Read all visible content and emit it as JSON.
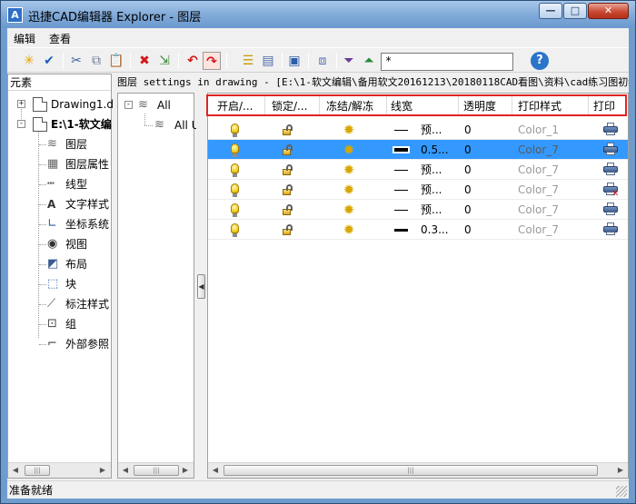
{
  "window": {
    "title": "迅捷CAD编辑器 Explorer - 图层",
    "app_icon": "A",
    "controls": {
      "minimize": "—",
      "maximize": "□",
      "close": "✕"
    }
  },
  "menu": [
    {
      "label": "编辑"
    },
    {
      "label": "查看"
    }
  ],
  "toolbar": {
    "filter_value": "*",
    "help_label": "?",
    "icons": [
      "new-icon",
      "check-icon",
      "cut-icon",
      "copy-icon",
      "paste-icon",
      "delete-icon",
      "export-icon",
      "undo-icon",
      "redo-icon",
      "layer-state-icon",
      "layer-filter-icon",
      "layer-props-icon",
      "layer-merge-icon",
      "filter-icon",
      "filter-invert-icon",
      "help-icon"
    ]
  },
  "left_panel": {
    "header": "元素",
    "tree": [
      {
        "label": "Drawing1.d",
        "level": 0,
        "expander": "+"
      },
      {
        "label": "E:\\1-软文编",
        "level": 0,
        "expander": "-",
        "bold": true
      },
      {
        "label": "图层",
        "level": 1,
        "icon": "layers-icon"
      },
      {
        "label": "图层属性",
        "level": 1,
        "icon": "layer-properties-icon"
      },
      {
        "label": "线型",
        "level": 1,
        "icon": "linetype-icon"
      },
      {
        "label": "文字样式",
        "level": 1,
        "icon": "text-style-icon"
      },
      {
        "label": "坐标系统",
        "level": 1,
        "icon": "ucs-icon"
      },
      {
        "label": "视图",
        "level": 1,
        "icon": "eye-icon"
      },
      {
        "label": "布局",
        "level": 1,
        "icon": "layout-icon"
      },
      {
        "label": "块",
        "level": 1,
        "icon": "block-icon"
      },
      {
        "label": "标注样式",
        "level": 1,
        "icon": "dimension-style-icon"
      },
      {
        "label": "组",
        "level": 1,
        "icon": "group-icon"
      },
      {
        "label": "外部参照",
        "level": 1,
        "icon": "xref-icon"
      }
    ]
  },
  "path_bar": "图层 settings in drawing - [E:\\1-软文编辑\\备用软文20161213\\20180118CAD看图\\资料\\cad练习图初级",
  "filter_tree": [
    {
      "label": "All",
      "expander": "-"
    },
    {
      "label": "All U"
    }
  ],
  "grid": {
    "columns": [
      "开启/...",
      "锁定/...",
      "冻结/解冻",
      "线宽",
      "透明度",
      "打印样式",
      "打印"
    ],
    "rows": [
      {
        "linewidth": "预...",
        "lw_weight": 1,
        "transparency": "0",
        "plot_style": "Color_1",
        "plottable": true,
        "selected": false
      },
      {
        "linewidth": "0.5...",
        "lw_weight": 4,
        "transparency": "0",
        "plot_style": "Color_7",
        "plottable": true,
        "selected": true
      },
      {
        "linewidth": "预...",
        "lw_weight": 1,
        "transparency": "0",
        "plot_style": "Color_7",
        "plottable": true,
        "selected": false
      },
      {
        "linewidth": "预...",
        "lw_weight": 1,
        "transparency": "0",
        "plot_style": "Color_7",
        "plottable": false,
        "selected": false
      },
      {
        "linewidth": "预...",
        "lw_weight": 1,
        "transparency": "0",
        "plot_style": "Color_7",
        "plottable": true,
        "selected": false
      },
      {
        "linewidth": "0.3...",
        "lw_weight": 3,
        "transparency": "0",
        "plot_style": "Color_7",
        "plottable": true,
        "selected": false
      }
    ]
  },
  "status": "准备就绪",
  "colors": {
    "selection": "#3399ff",
    "highlight_border": "#e02424",
    "title_gradient_top": "#a7c7ea"
  }
}
